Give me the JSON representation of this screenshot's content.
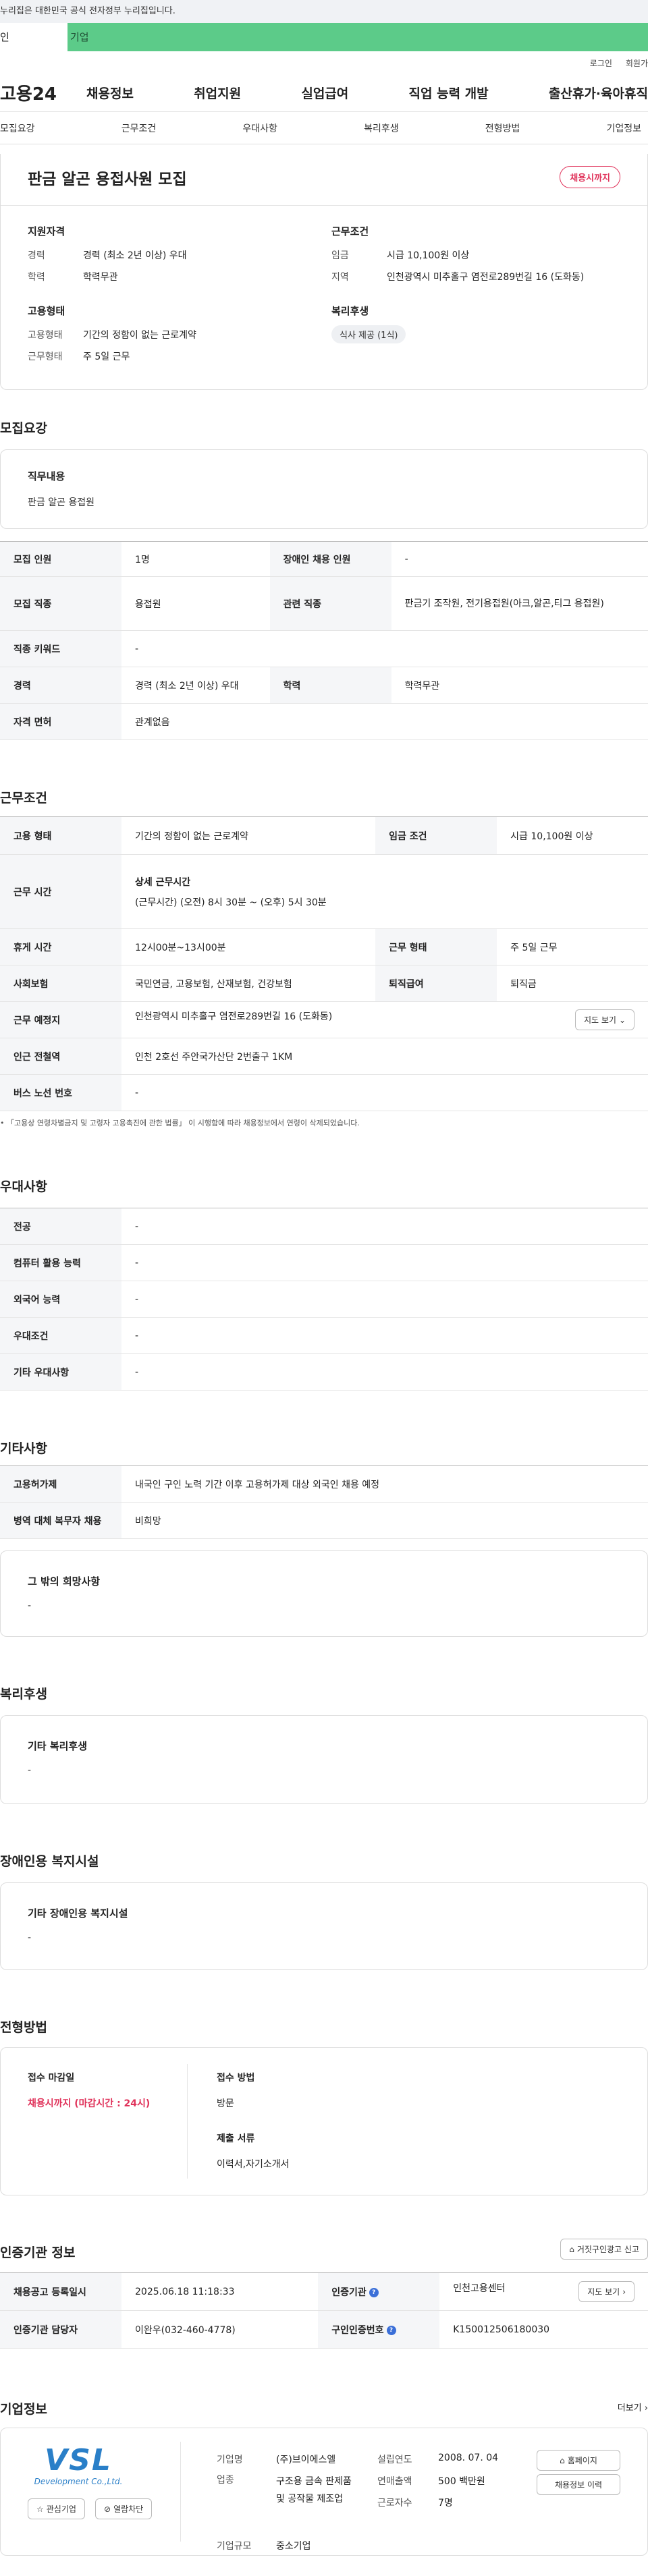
{
  "gov_notice": "누리집은 대한민국 공식 전자정부 누리집입니다.",
  "top_tabs": [
    "인",
    "기업"
  ],
  "util": [
    "로그인",
    "회원가"
  ],
  "logo": "고용24",
  "gnb": [
    "채용정보",
    "취업지원",
    "실업급여",
    "직업 능력 개발",
    "출산휴가·육아휴직"
  ],
  "subnav": [
    "모집요강",
    "근무조건",
    "우대사항",
    "복리후생",
    "전형방법",
    "기업정보"
  ],
  "hero": {
    "title": "판금 알곤 용접사원 모집",
    "badge": "채용시까지",
    "qual_h": "지원자격",
    "career_k": "경력",
    "career_v": "경력 (최소 2년 이상) 우대",
    "edu_k": "학력",
    "edu_v": "학력무관",
    "cond_h": "근무조건",
    "wage_k": "임금",
    "wage_v": "시급 10,100원 이상",
    "loc_k": "지역",
    "loc_v": "인천광역시 미추홀구 염전로289번길 16 (도화동)",
    "emp_h": "고용형태",
    "emp_k": "고용형태",
    "emp_v": "기간의 정함이 없는 근로계약",
    "work_k": "근무형태",
    "work_v": "주 5일 근무",
    "wel_h": "복리후생",
    "wel_tag": "식사 제공 (1식)"
  },
  "recruit": {
    "title": "모집요강",
    "job_h": "직무내용",
    "job_v": "판금 알곤 용접원",
    "rows": [
      [
        "모집 인원",
        "1명",
        "장애인 채용 인원",
        "-"
      ],
      [
        "모집 직종",
        "용접원",
        "관련 직종",
        "판금기 조작원, 전기용접원(아크,알곤,티그 용접원)"
      ],
      [
        "직종 키워드",
        "-"
      ],
      [
        "경력",
        "경력 (최소 2년 이상) 우대",
        "학력",
        "학력무관"
      ],
      [
        "자격 면허",
        "관계없음"
      ]
    ]
  },
  "cond": {
    "title": "근무조건",
    "r1": [
      "고용 형태",
      "기간의 정함이 없는 근로계약",
      "임금 조건",
      "시급 10,100원 이상"
    ],
    "time_k": "근무 시간",
    "time_h": "상세 근무시간",
    "time_v": "(근무시간) (오전) 8시 30분 ~ (오후) 5시 30분",
    "r3": [
      "휴게 시간",
      "12시00분~13시00분",
      "근무 형태",
      "주 5일 근무"
    ],
    "r4": [
      "사회보험",
      "국민연금, 고용보험, 산재보험, 건강보험",
      "퇴직급여",
      "퇴직금"
    ],
    "loc_k": "근무 예정지",
    "loc_v": "인천광역시 미추홀구 염전로289번길 16 (도화동)",
    "map_btn": "지도 보기",
    "sub_k": "인근 전철역",
    "sub_v": "인천 2호선 주안국가산단 2번출구 1KM",
    "bus_k": "버스 노선 번호",
    "bus_v": "-",
    "note": "「고용상 연령차별금지 및 고령자 고용촉진에 관한 법률」 이 시행함에 따라 채용정보에서 연령이 삭제되었습니다."
  },
  "pref": {
    "title": "우대사항",
    "rows": [
      [
        "전공",
        "-"
      ],
      [
        "컴퓨터 활용 능력",
        "-"
      ],
      [
        "외국어 능력",
        "-"
      ],
      [
        "우대조건",
        "-"
      ],
      [
        "기타 우대사항",
        "-"
      ]
    ]
  },
  "etc": {
    "title": "기타사항",
    "rows": [
      [
        "고용허가제",
        "내국인 구인 노력 기간 이후 고용허가제 대상 외국인 채용 예정"
      ],
      [
        "병역 대체 복무자 채용",
        "비희망"
      ]
    ],
    "hope_h": "그 밖의 희망사항",
    "hope_v": "-"
  },
  "welfare": {
    "title": "복리후생",
    "h": "기타 복리후생",
    "v": "-"
  },
  "disabled": {
    "title": "장애인용 복지시설",
    "h": "기타 장애인용 복지시설",
    "v": "-"
  },
  "screen": {
    "title": "전형방법",
    "deadline_h": "접수 마감일",
    "deadline_v": "채용시까지 (마감시간 : 24시)",
    "method_h": "접수 방법",
    "method_v": "방문",
    "docs_h": "제출 서류",
    "docs_v": "이력서,자기소개서"
  },
  "auth": {
    "title": "인증기관 정보",
    "report_btn": "거짓구인광고 신고",
    "reg_k": "채용공고 등록일시",
    "reg_v": "2025.06.18 11:18:33",
    "org_k": "인증기관",
    "org_v": "인천고용센터",
    "map_btn": "지도 보기",
    "mgr_k": "인증기관 담당자",
    "mgr_v": "이완우(032-460-4778)",
    "num_k": "구인인증번호",
    "num_v": "K150012506180030"
  },
  "company": {
    "title": "기업정보",
    "more": "더보기",
    "logo": "VSL",
    "logo_sub": "Development Co.,Ltd.",
    "fav_btn": "관심기업",
    "block_btn": "열람차단",
    "name_k": "기업명",
    "name_v": "(주)브이에스엘",
    "ind_k": "업종",
    "ind_v": "구조용 금속 판제품 및 공작물 제조업",
    "size_k": "기업규모",
    "size_v": "중소기업",
    "est_k": "설립연도",
    "est_v": "2008. 07. 04",
    "sales_k": "연매출액",
    "sales_v": "500 백만원",
    "emp_k": "근로자수",
    "emp_v": "7명",
    "home_btn": "홈페이지",
    "jobs_btn": "채용정보 이력"
  }
}
